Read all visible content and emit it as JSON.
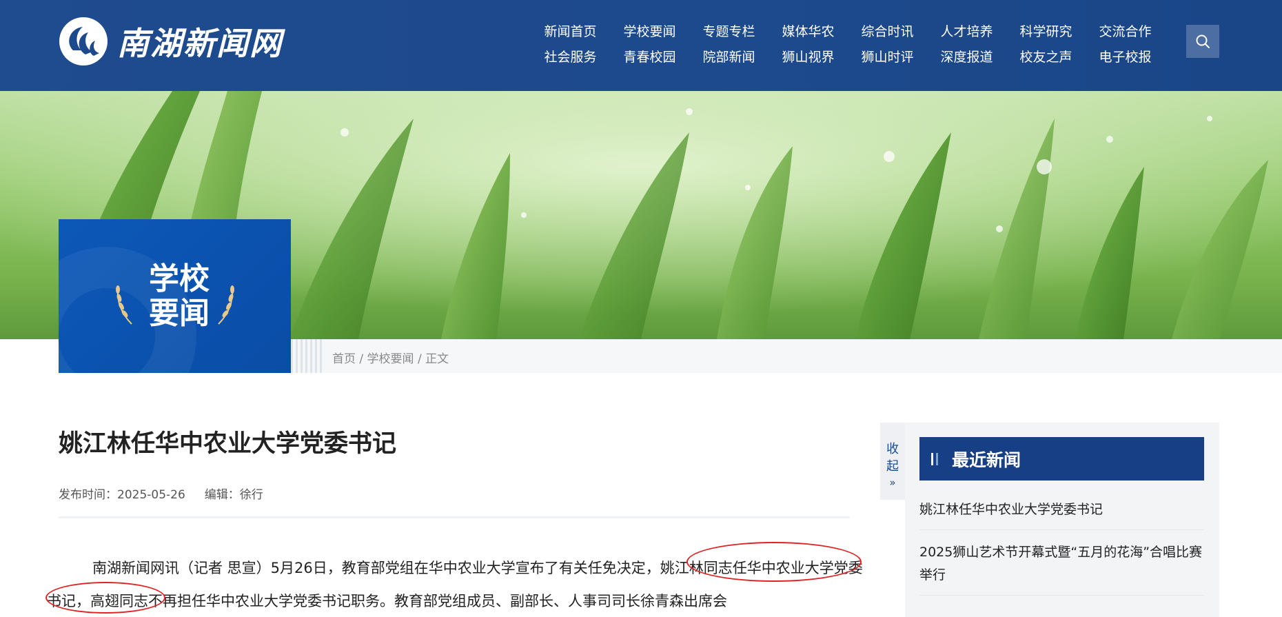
{
  "header": {
    "logo_text": "南湖新闻网",
    "nav_row1": [
      "新闻首页",
      "学校要闻",
      "专题专栏",
      "媒体华农",
      "综合时讯",
      "人才培养",
      "科学研究",
      "交流合作"
    ],
    "nav_row2": [
      "社会服务",
      "青春校园",
      "院部新闻",
      "狮山视界",
      "狮山时评",
      "深度报道",
      "校友之声",
      "电子校报"
    ],
    "search_icon": "search-icon"
  },
  "section": {
    "title_line1": "学校",
    "title_line2": "要闻"
  },
  "breadcrumb": {
    "home": "首页",
    "sep1": " / ",
    "section": "学校要闻",
    "sep2": " / ",
    "current": "正文"
  },
  "article": {
    "title": "姚江林任华中农业大学党委书记",
    "publish_label": "发布时间：",
    "publish_date": "2025-05-26",
    "editor_label": "编辑：",
    "editor": "徐行",
    "para_text1": "南湖新闻网讯（记者 思宣）5月26日，教育部党组在华中农业大学宣布了有关任免决定，",
    "para_highlight": "姚江林同志任华中农业大学党委书记",
    "para_text2": "，高翅同志不再担任华中农业大学党委书记职务。教育部党组成员、副部长、人事司司长徐青森出席会"
  },
  "sidebar": {
    "collapse_label_1": "收",
    "collapse_label_2": "起",
    "collapse_icon": "double-chevron-right-icon",
    "title": "最近新闻",
    "news": [
      "姚江林任华中农业大学党委书记",
      "2025狮山艺术节开幕式暨“五月的花海”合唱比赛举行"
    ]
  },
  "colors": {
    "header_bg": "#1d4a8c",
    "section_badge": "#0a52b0",
    "sidebar_head": "#163f86",
    "highlight_circle": "#e22222"
  }
}
